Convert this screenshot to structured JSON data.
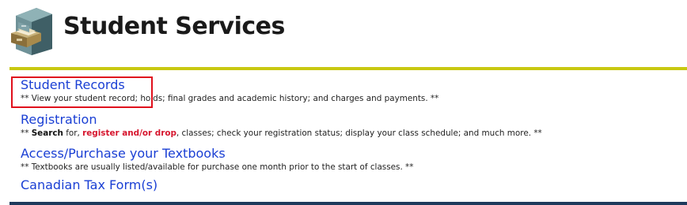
{
  "header": {
    "title": "Student Services",
    "icon": "filing-cabinet-icon"
  },
  "colors": {
    "accent_rule": "#c8c810",
    "link": "#1a3fd4",
    "highlight": "#e0101c",
    "keyword_red": "#d6162e",
    "bottom_rule": "#1e3a5c"
  },
  "menu": {
    "student_records": {
      "label": "Student Records",
      "desc": "** View your student record; holds; final grades and academic history; and charges and payments. **"
    },
    "registration": {
      "label": "Registration",
      "desc_prefix": "** ",
      "desc_search": "Search",
      "desc_for": " for, ",
      "desc_register": "register and/or drop",
      "desc_rest": ", classes; check your registration status; display your class schedule; and much more. **"
    },
    "textbooks": {
      "label": "Access/Purchase your Textbooks",
      "desc": "** Textbooks are usually listed/available for purchase one month prior to the start of classes. **"
    },
    "tax_forms": {
      "label": "Canadian Tax Form(s)"
    }
  }
}
